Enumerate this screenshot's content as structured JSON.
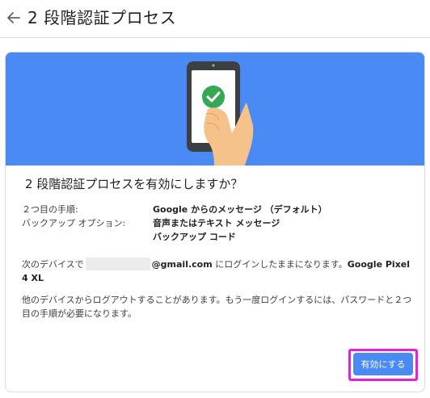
{
  "header": {
    "back_icon": "arrow-back-icon",
    "title": "2 段階認証プロセス"
  },
  "banner": {
    "background_color": "#4a8af4",
    "illustration": "phone-check-icon",
    "check_color": "#34a853"
  },
  "dialog": {
    "title": "2 段階認証プロセスを有効にしますか？",
    "details": [
      {
        "label": "２つ目の手順:",
        "values": [
          "Google からのメッセージ （デフォルト）"
        ]
      },
      {
        "label": "バックアップ オプション:",
        "values": [
          "音声またはテキスト メッセージ",
          "バックアップ コード"
        ]
      }
    ],
    "device_text_prefix": "次のデバイスで",
    "email_suffix": "@gmail.com",
    "device_text_middle": " にログインしたままになります。",
    "device_name": "Google Pixel 4 XL",
    "logout_notice": "他のデバイスからログアウトすることがあります。もう一度ログインするには、パスワードと２つ目の手順が必要になります。",
    "enable_button_label": "有効にする",
    "accent_color": "#4a8af4",
    "highlight_color": "#e81de0"
  }
}
